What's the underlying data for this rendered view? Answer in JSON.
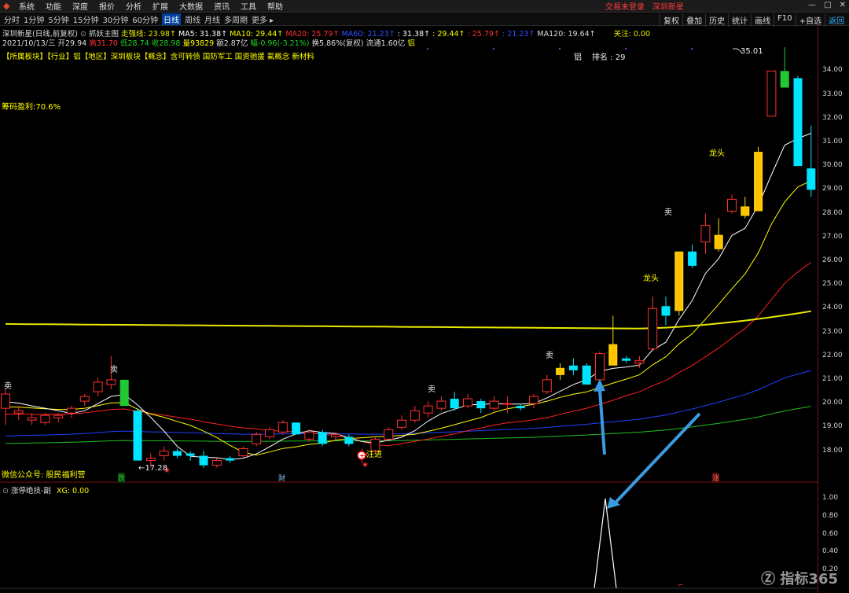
{
  "menu": {
    "items": [
      "系统",
      "功能",
      "深度",
      "报价",
      "分析",
      "扩展",
      "大数据",
      "资讯",
      "工具",
      "帮助"
    ],
    "status_login": "交易未登录",
    "status_stock": "深圳新星",
    "win_buttons": [
      "—",
      "□",
      "✕"
    ]
  },
  "toolbar": {
    "periods": [
      "分时",
      "1分钟",
      "5分钟",
      "15分钟",
      "30分钟",
      "60分钟",
      "日线",
      "周线",
      "月线",
      "多周期",
      "更多 ▸"
    ],
    "active_period": "日线",
    "right_buttons": [
      "复权",
      "叠加",
      "历史",
      "统计",
      "画线",
      "F10",
      "+自选",
      "返回"
    ]
  },
  "header": {
    "stock_name": "深圳新星",
    "chart_mode": "(日线,前复权)",
    "indicator_name": "抓妖主图",
    "trend_line": "走强线: 23.98↑",
    "ma5": "MA5: 31.38↑",
    "ma10": "MA10: 29.44↑",
    "ma20": "MA20: 25.79↑",
    "ma60": "MA60: 21.23↑",
    "ma60b": ": 31.38↑",
    "ma60c": ": 29.44↑",
    "ma60d": ": 25.79↑",
    "ma60e": ": 21.23↑",
    "ma120": "MA120: 19.64↑",
    "focus": "关注: 0.00"
  },
  "quote": {
    "date": "2021/10/13/三",
    "open": "开29.94",
    "high": "高31.70",
    "low": "低28.74",
    "close": "收28.98",
    "volume": "量93829",
    "amount": "额2.87亿",
    "change": "幅-0.96(-3.21%)",
    "turnover": "换5.86%(复权)",
    "float": "流通1.60亿",
    "sector_tag": "铝"
  },
  "concepts": "【所属板块】【行业】铝【地区】深圳板块【概念】含可转债 国防军工 国资驰援 氟概念 新材料",
  "rank": {
    "name": "铝",
    "label": "排名 : 29"
  },
  "chips_profit": "筹码盈利:70.6%",
  "wechat": "微信公众号: 股民福利营",
  "annotations": {
    "sell": "卖",
    "dragon": "龙头",
    "enter": "注进",
    "low_price": "←17.28",
    "high_price": "35.01",
    "fall": "跌",
    "finance": "财",
    "rise": "涨"
  },
  "sub_chart": {
    "title": "涨停绝技-副",
    "xg": "XG: 0.00"
  },
  "y_axis_main": [
    "34.00",
    "33.00",
    "32.00",
    "31.00",
    "30.00",
    "29.00",
    "28.00",
    "27.00",
    "26.00",
    "25.00",
    "24.00",
    "23.00",
    "22.00",
    "21.00",
    "20.00",
    "19.00",
    "18.00"
  ],
  "y_axis_sub": [
    "1.00",
    "0.80",
    "0.60",
    "0.40",
    "0.20"
  ],
  "watermark": "指标365",
  "colors": {
    "up": "#ff3030",
    "down": "#00e5ff",
    "zt": "#ffd400",
    "green_block": "#22c832",
    "ma5": "#ffffff",
    "ma10": "#ffff00",
    "ma20": "#ff2020",
    "ma60": "#2040ff",
    "ma120": "#20c020",
    "trend": "#e8e800",
    "arrow": "#3a9be0"
  },
  "chart_data": {
    "type": "candlestick",
    "candles": [
      [
        19.8,
        20.6,
        19.1,
        20.4
      ],
      [
        19.6,
        19.9,
        19.3,
        19.7
      ],
      [
        19.3,
        19.6,
        19.1,
        19.4
      ],
      [
        19.2,
        19.6,
        19.1,
        19.5
      ],
      [
        19.4,
        19.6,
        19.2,
        19.5
      ],
      [
        19.6,
        19.9,
        19.4,
        19.8
      ],
      [
        20.1,
        20.4,
        19.9,
        20.3
      ],
      [
        20.5,
        21.1,
        20.3,
        20.9
      ],
      [
        20.8,
        22.0,
        20.6,
        21.0
      ],
      [
        21.0,
        21.0,
        19.9,
        19.9
      ],
      [
        19.7,
        19.8,
        17.6,
        17.6
      ],
      [
        17.6,
        17.9,
        17.3,
        17.7
      ],
      [
        17.8,
        18.2,
        17.6,
        18.0
      ],
      [
        18.0,
        18.1,
        17.7,
        17.8
      ],
      [
        17.9,
        18.0,
        17.6,
        17.8
      ],
      [
        17.8,
        18.0,
        17.3,
        17.4
      ],
      [
        17.4,
        17.7,
        17.3,
        17.6
      ],
      [
        17.7,
        17.8,
        17.5,
        17.6
      ],
      [
        17.8,
        18.2,
        17.7,
        18.1
      ],
      [
        18.3,
        18.8,
        18.2,
        18.7
      ],
      [
        18.6,
        19.0,
        18.5,
        18.9
      ],
      [
        18.8,
        19.3,
        18.7,
        19.2
      ],
      [
        19.2,
        19.2,
        18.7,
        18.7
      ],
      [
        18.5,
        18.9,
        18.4,
        18.8
      ],
      [
        18.8,
        18.9,
        18.2,
        18.3
      ],
      [
        18.6,
        18.8,
        18.4,
        18.7
      ],
      [
        18.6,
        18.7,
        18.2,
        18.3
      ],
      [
        17.8,
        18.1,
        17.5,
        17.9
      ],
      [
        18.0,
        18.6,
        17.9,
        18.5
      ],
      [
        18.5,
        19.0,
        18.4,
        18.9
      ],
      [
        19.0,
        19.5,
        18.9,
        19.3
      ],
      [
        19.3,
        19.9,
        19.2,
        19.7
      ],
      [
        19.6,
        20.1,
        19.4,
        19.9
      ],
      [
        19.8,
        20.3,
        19.7,
        20.1
      ],
      [
        20.2,
        20.5,
        19.7,
        19.8
      ],
      [
        19.9,
        20.4,
        19.8,
        20.2
      ],
      [
        20.1,
        20.2,
        19.6,
        19.8
      ],
      [
        19.8,
        20.3,
        19.7,
        20.1
      ],
      [
        20.0,
        20.3,
        19.6,
        20.0
      ],
      [
        19.9,
        20.0,
        19.7,
        19.8
      ],
      [
        20.0,
        20.4,
        19.8,
        20.3
      ],
      [
        20.5,
        21.2,
        20.4,
        21.0
      ],
      [
        21.2,
        21.7,
        21.0,
        21.5
      ],
      [
        21.6,
        21.9,
        21.2,
        21.4
      ],
      [
        21.6,
        21.7,
        20.8,
        20.8
      ],
      [
        21.0,
        22.2,
        20.9,
        22.1
      ],
      [
        22.5,
        23.7,
        22.0,
        21.6
      ],
      [
        21.9,
        22.0,
        21.7,
        21.8
      ],
      [
        21.7,
        22.0,
        21.5,
        21.8
      ],
      [
        22.3,
        24.5,
        22.3,
        24.0
      ],
      [
        24.1,
        24.5,
        23.3,
        23.7
      ],
      [
        23.9,
        26.1,
        23.7,
        26.4
      ],
      [
        26.4,
        26.7,
        25.7,
        25.8
      ],
      [
        26.8,
        28.0,
        26.3,
        27.5
      ],
      [
        26.5,
        27.8,
        26.4,
        27.1
      ],
      [
        28.1,
        28.8,
        28.0,
        28.6
      ],
      [
        28.3,
        28.7,
        27.8,
        27.9
      ],
      [
        28.1,
        30.8,
        28.1,
        30.6
      ],
      [
        32.1,
        34.0,
        32.1,
        34.0
      ],
      [
        34.0,
        35.0,
        33.5,
        33.3
      ],
      [
        33.7,
        33.8,
        30.0,
        30.0
      ],
      [
        29.9,
        31.7,
        28.7,
        29.0
      ]
    ],
    "zt_candles": [
      42,
      46,
      51,
      54,
      56,
      57
    ],
    "green_block_candles": [
      9,
      59
    ],
    "subchart_signal": {
      "index": 45,
      "value": 1.0
    },
    "ylim_main": [
      17.0,
      35.5
    ],
    "ylim_sub": [
      0,
      1.1
    ]
  }
}
